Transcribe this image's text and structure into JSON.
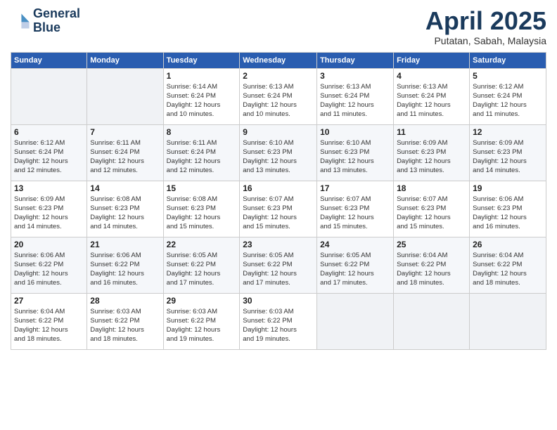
{
  "header": {
    "logo_line1": "General",
    "logo_line2": "Blue",
    "month_title": "April 2025",
    "location": "Putatan, Sabah, Malaysia"
  },
  "weekdays": [
    "Sunday",
    "Monday",
    "Tuesday",
    "Wednesday",
    "Thursday",
    "Friday",
    "Saturday"
  ],
  "weeks": [
    [
      {
        "day": "",
        "info": ""
      },
      {
        "day": "",
        "info": ""
      },
      {
        "day": "1",
        "info": "Sunrise: 6:14 AM\nSunset: 6:24 PM\nDaylight: 12 hours\nand 10 minutes."
      },
      {
        "day": "2",
        "info": "Sunrise: 6:13 AM\nSunset: 6:24 PM\nDaylight: 12 hours\nand 10 minutes."
      },
      {
        "day": "3",
        "info": "Sunrise: 6:13 AM\nSunset: 6:24 PM\nDaylight: 12 hours\nand 11 minutes."
      },
      {
        "day": "4",
        "info": "Sunrise: 6:13 AM\nSunset: 6:24 PM\nDaylight: 12 hours\nand 11 minutes."
      },
      {
        "day": "5",
        "info": "Sunrise: 6:12 AM\nSunset: 6:24 PM\nDaylight: 12 hours\nand 11 minutes."
      }
    ],
    [
      {
        "day": "6",
        "info": "Sunrise: 6:12 AM\nSunset: 6:24 PM\nDaylight: 12 hours\nand 12 minutes."
      },
      {
        "day": "7",
        "info": "Sunrise: 6:11 AM\nSunset: 6:24 PM\nDaylight: 12 hours\nand 12 minutes."
      },
      {
        "day": "8",
        "info": "Sunrise: 6:11 AM\nSunset: 6:24 PM\nDaylight: 12 hours\nand 12 minutes."
      },
      {
        "day": "9",
        "info": "Sunrise: 6:10 AM\nSunset: 6:23 PM\nDaylight: 12 hours\nand 13 minutes."
      },
      {
        "day": "10",
        "info": "Sunrise: 6:10 AM\nSunset: 6:23 PM\nDaylight: 12 hours\nand 13 minutes."
      },
      {
        "day": "11",
        "info": "Sunrise: 6:09 AM\nSunset: 6:23 PM\nDaylight: 12 hours\nand 13 minutes."
      },
      {
        "day": "12",
        "info": "Sunrise: 6:09 AM\nSunset: 6:23 PM\nDaylight: 12 hours\nand 14 minutes."
      }
    ],
    [
      {
        "day": "13",
        "info": "Sunrise: 6:09 AM\nSunset: 6:23 PM\nDaylight: 12 hours\nand 14 minutes."
      },
      {
        "day": "14",
        "info": "Sunrise: 6:08 AM\nSunset: 6:23 PM\nDaylight: 12 hours\nand 14 minutes."
      },
      {
        "day": "15",
        "info": "Sunrise: 6:08 AM\nSunset: 6:23 PM\nDaylight: 12 hours\nand 15 minutes."
      },
      {
        "day": "16",
        "info": "Sunrise: 6:07 AM\nSunset: 6:23 PM\nDaylight: 12 hours\nand 15 minutes."
      },
      {
        "day": "17",
        "info": "Sunrise: 6:07 AM\nSunset: 6:23 PM\nDaylight: 12 hours\nand 15 minutes."
      },
      {
        "day": "18",
        "info": "Sunrise: 6:07 AM\nSunset: 6:23 PM\nDaylight: 12 hours\nand 15 minutes."
      },
      {
        "day": "19",
        "info": "Sunrise: 6:06 AM\nSunset: 6:23 PM\nDaylight: 12 hours\nand 16 minutes."
      }
    ],
    [
      {
        "day": "20",
        "info": "Sunrise: 6:06 AM\nSunset: 6:22 PM\nDaylight: 12 hours\nand 16 minutes."
      },
      {
        "day": "21",
        "info": "Sunrise: 6:06 AM\nSunset: 6:22 PM\nDaylight: 12 hours\nand 16 minutes."
      },
      {
        "day": "22",
        "info": "Sunrise: 6:05 AM\nSunset: 6:22 PM\nDaylight: 12 hours\nand 17 minutes."
      },
      {
        "day": "23",
        "info": "Sunrise: 6:05 AM\nSunset: 6:22 PM\nDaylight: 12 hours\nand 17 minutes."
      },
      {
        "day": "24",
        "info": "Sunrise: 6:05 AM\nSunset: 6:22 PM\nDaylight: 12 hours\nand 17 minutes."
      },
      {
        "day": "25",
        "info": "Sunrise: 6:04 AM\nSunset: 6:22 PM\nDaylight: 12 hours\nand 18 minutes."
      },
      {
        "day": "26",
        "info": "Sunrise: 6:04 AM\nSunset: 6:22 PM\nDaylight: 12 hours\nand 18 minutes."
      }
    ],
    [
      {
        "day": "27",
        "info": "Sunrise: 6:04 AM\nSunset: 6:22 PM\nDaylight: 12 hours\nand 18 minutes."
      },
      {
        "day": "28",
        "info": "Sunrise: 6:03 AM\nSunset: 6:22 PM\nDaylight: 12 hours\nand 18 minutes."
      },
      {
        "day": "29",
        "info": "Sunrise: 6:03 AM\nSunset: 6:22 PM\nDaylight: 12 hours\nand 19 minutes."
      },
      {
        "day": "30",
        "info": "Sunrise: 6:03 AM\nSunset: 6:22 PM\nDaylight: 12 hours\nand 19 minutes."
      },
      {
        "day": "",
        "info": ""
      },
      {
        "day": "",
        "info": ""
      },
      {
        "day": "",
        "info": ""
      }
    ]
  ]
}
